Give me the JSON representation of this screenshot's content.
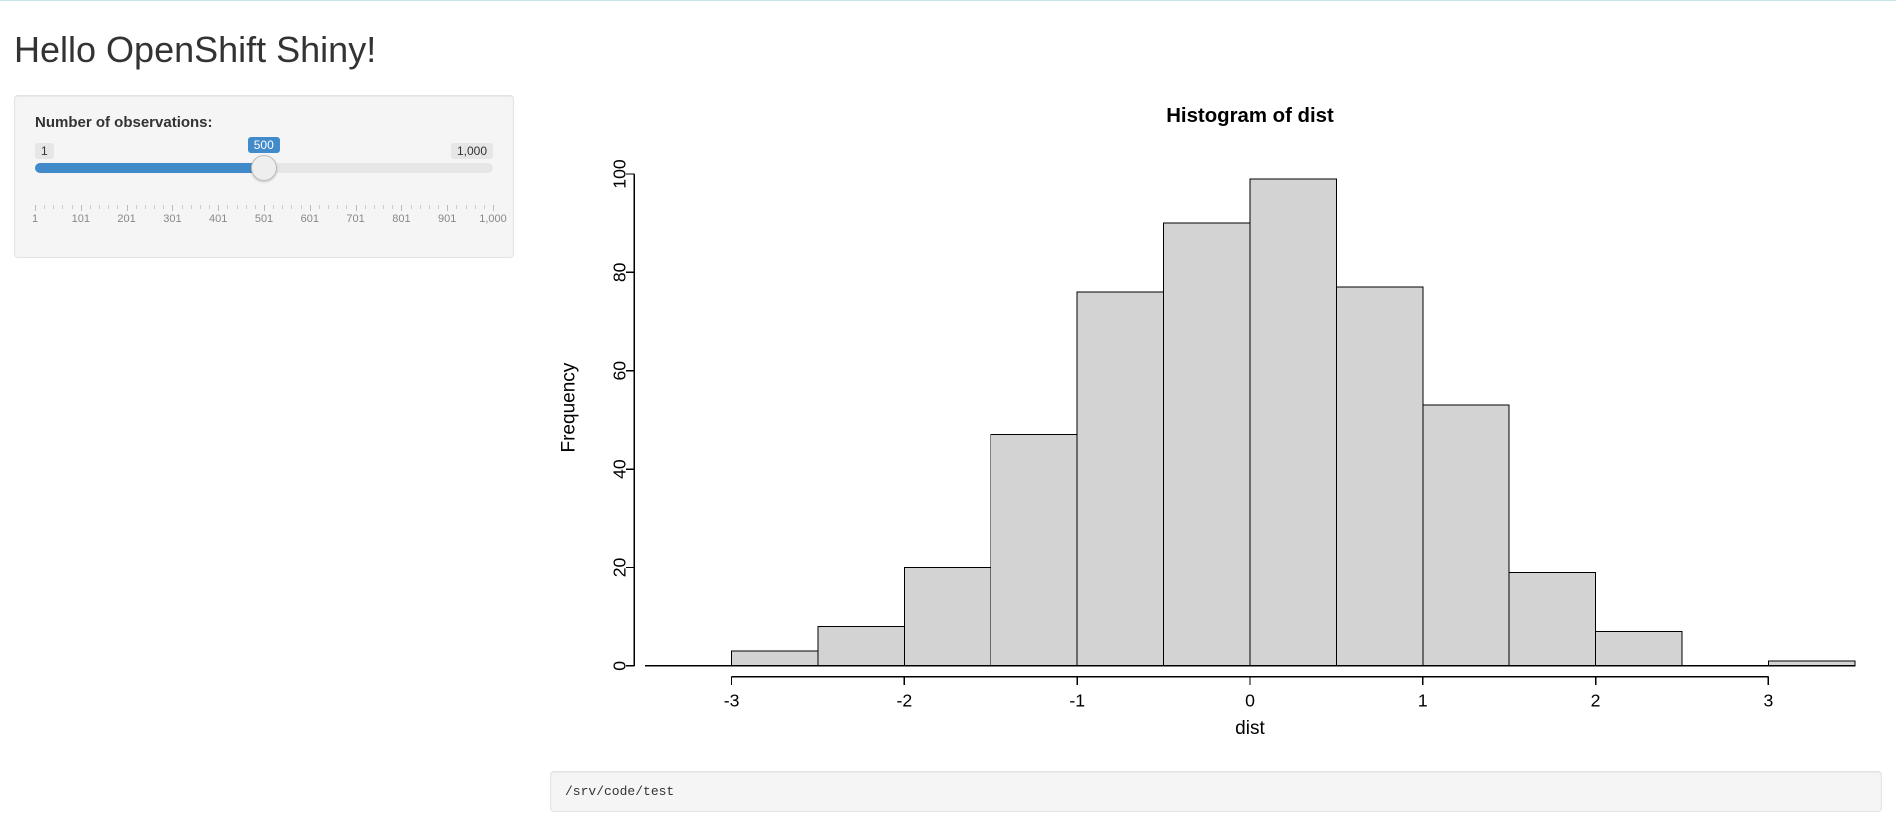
{
  "title": "Hello OpenShift Shiny!",
  "slider": {
    "label": "Number of observations:",
    "min_label": "1",
    "max_label": "1,000",
    "value_label": "500",
    "min": 1,
    "max": 1000,
    "value": 500,
    "ticks": [
      "1",
      "101",
      "201",
      "301",
      "401",
      "501",
      "601",
      "701",
      "801",
      "901",
      "1,000"
    ]
  },
  "chart_data": {
    "type": "bar",
    "title": "Histogram of dist",
    "xlabel": "dist",
    "ylabel": "Frequency",
    "bins": [
      {
        "x0": -3.5,
        "x1": -3.0,
        "count": 0
      },
      {
        "x0": -3.0,
        "x1": -2.5,
        "count": 3
      },
      {
        "x0": -2.5,
        "x1": -2.0,
        "count": 8
      },
      {
        "x0": -2.0,
        "x1": -1.5,
        "count": 20
      },
      {
        "x0": -1.5,
        "x1": -1.0,
        "count": 47
      },
      {
        "x0": -1.0,
        "x1": -0.5,
        "count": 76
      },
      {
        "x0": -0.5,
        "x1": 0.0,
        "count": 90
      },
      {
        "x0": 0.0,
        "x1": 0.5,
        "count": 99
      },
      {
        "x0": 0.5,
        "x1": 1.0,
        "count": 77
      },
      {
        "x0": 1.0,
        "x1": 1.5,
        "count": 53
      },
      {
        "x0": 1.5,
        "x1": 2.0,
        "count": 19
      },
      {
        "x0": 2.0,
        "x1": 2.5,
        "count": 7
      },
      {
        "x0": 2.5,
        "x1": 3.0,
        "count": 0
      },
      {
        "x0": 3.0,
        "x1": 3.5,
        "count": 1
      }
    ],
    "x_ticks": [
      -3,
      -2,
      -1,
      0,
      1,
      2,
      3
    ],
    "y_ticks": [
      0,
      20,
      40,
      60,
      80,
      100
    ],
    "xlim": [
      -3.5,
      3.5
    ],
    "ylim": [
      0,
      105
    ]
  },
  "output": {
    "text": "/srv/code/test"
  }
}
